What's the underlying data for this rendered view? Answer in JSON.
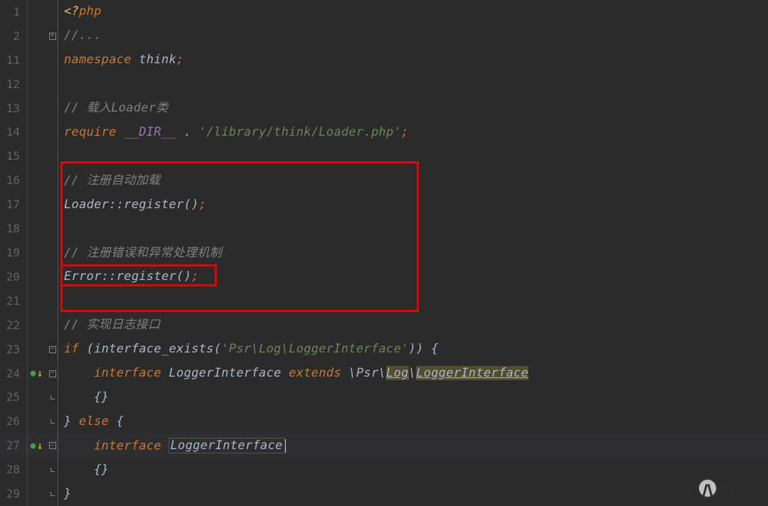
{
  "logo_text_top": "创新互联",
  "logo_text_bottom": "CHUANG XIN HU LIAN",
  "lines": [
    {
      "num": "1",
      "fold": "",
      "tokens": [
        [
          "tk-tag",
          "<?"
        ],
        [
          "tk-kw",
          "php"
        ]
      ]
    },
    {
      "num": "2",
      "fold": "+",
      "tokens": [
        [
          "tk-comment",
          "//..."
        ]
      ]
    },
    {
      "num": "11",
      "fold": "",
      "tokens": [
        [
          "tk-kw",
          "namespace"
        ],
        [
          "tk-id",
          " think"
        ],
        [
          "tk-semico",
          ";"
        ]
      ]
    },
    {
      "num": "12",
      "fold": "",
      "tokens": []
    },
    {
      "num": "13",
      "fold": "",
      "tokens": [
        [
          "tk-comment",
          "// 载入Loader类"
        ]
      ]
    },
    {
      "num": "14",
      "fold": "",
      "tokens": [
        [
          "tk-kw",
          "require"
        ],
        [
          "tk-id",
          " "
        ],
        [
          "tk-mag",
          "__DIR__"
        ],
        [
          "tk-id",
          " "
        ],
        [
          "tk-op",
          "."
        ],
        [
          "tk-id",
          " "
        ],
        [
          "tk-str",
          "'/library/think/Loader.php'"
        ],
        [
          "tk-semico",
          ";"
        ]
      ]
    },
    {
      "num": "15",
      "fold": "",
      "tokens": []
    },
    {
      "num": "16",
      "fold": "",
      "tokens": [
        [
          "tk-comment",
          "// 注册自动加载"
        ]
      ]
    },
    {
      "num": "17",
      "fold": "",
      "tokens": [
        [
          "tk-id",
          "Loader"
        ],
        [
          "tk-op",
          "::"
        ],
        [
          "tk-fn",
          "register()"
        ],
        [
          "tk-semico",
          ";"
        ]
      ]
    },
    {
      "num": "18",
      "fold": "",
      "tokens": []
    },
    {
      "num": "19",
      "fold": "",
      "tokens": [
        [
          "tk-comment",
          "// 注册错误和异常处理机制"
        ]
      ]
    },
    {
      "num": "20",
      "fold": "",
      "tokens": [
        [
          "tk-id",
          "Error"
        ],
        [
          "tk-op",
          "::"
        ],
        [
          "tk-fn",
          "register()"
        ],
        [
          "tk-semico",
          ";"
        ]
      ]
    },
    {
      "num": "21",
      "fold": "",
      "tokens": []
    },
    {
      "num": "22",
      "fold": "",
      "tokens": [
        [
          "tk-comment",
          "// 实现日志接口"
        ]
      ]
    },
    {
      "num": "23",
      "fold": "-",
      "tokens": [
        [
          "tk-kw",
          "if"
        ],
        [
          "tk-id",
          " ("
        ],
        [
          "tk-id",
          "interface_exists"
        ],
        [
          "tk-id",
          "("
        ],
        [
          "tk-str",
          "'Psr\\Log\\LoggerInterface'"
        ],
        [
          "tk-id",
          ")) {"
        ]
      ]
    },
    {
      "num": "24",
      "fold": "-",
      "status": true,
      "tokens": [
        [
          "tk-id",
          "    "
        ],
        [
          "tk-kw",
          "interface"
        ],
        [
          "tk-id",
          " LoggerInterface "
        ],
        [
          "tk-kw",
          "extends"
        ],
        [
          "tk-id",
          " \\Psr\\"
        ],
        [
          "hl-word underline-deco",
          "Log"
        ],
        [
          "tk-id",
          "\\"
        ],
        [
          "hl-word underline-deco",
          "LoggerInterface"
        ]
      ]
    },
    {
      "num": "25",
      "fold": "u",
      "tokens": [
        [
          "tk-id",
          "    {}"
        ]
      ]
    },
    {
      "num": "26",
      "fold": "u",
      "tokens": [
        [
          "tk-id",
          "} "
        ],
        [
          "tk-kw",
          "else"
        ],
        [
          "tk-id",
          " {"
        ]
      ]
    },
    {
      "num": "27",
      "fold": "-",
      "status": true,
      "cursor": true,
      "hl": true,
      "tokens": [
        [
          "tk-id",
          "    "
        ],
        [
          "tk-kw",
          "interface"
        ],
        [
          "tk-id",
          " "
        ],
        [
          "hl-box",
          "LoggerInterface"
        ]
      ]
    },
    {
      "num": "28",
      "fold": "u",
      "tokens": [
        [
          "tk-id",
          "    {}"
        ]
      ]
    },
    {
      "num": "29",
      "fold": "u",
      "tokens": [
        [
          "tk-id",
          "}"
        ]
      ]
    }
  ]
}
